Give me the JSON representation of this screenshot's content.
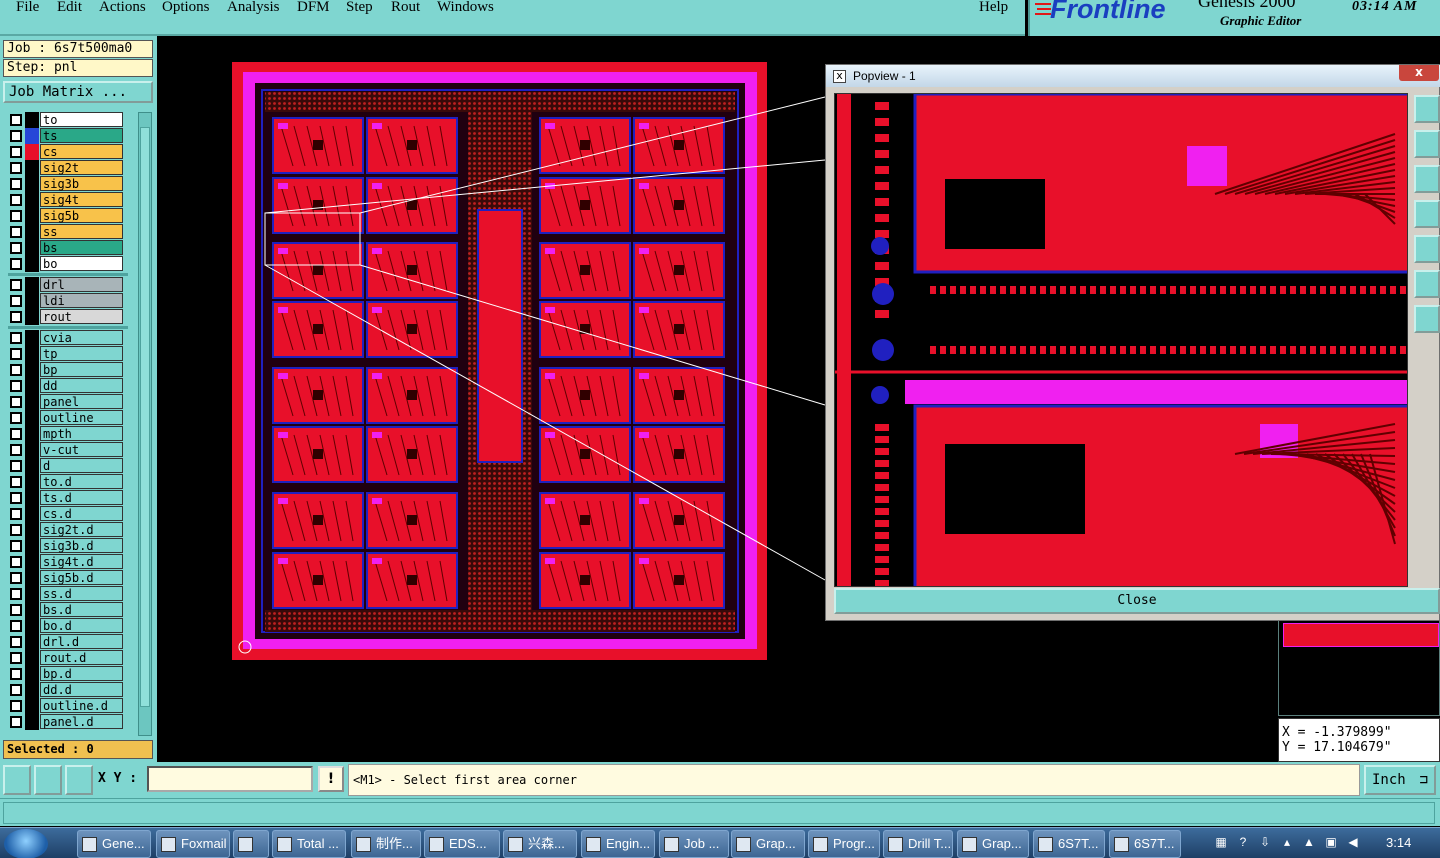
{
  "menu": [
    {
      "label": "File"
    },
    {
      "label": "Edit"
    },
    {
      "label": "Actions"
    },
    {
      "label": "Options"
    },
    {
      "label": "Analysis"
    },
    {
      "label": "DFM"
    },
    {
      "label": "Step"
    },
    {
      "label": "Rout"
    },
    {
      "label": "Windows"
    },
    {
      "label": "Help"
    }
  ],
  "brand": {
    "logo": "Frontline",
    "product": "Genesis 2000",
    "subtitle": "Graphic Editor",
    "clock": "03:14 AM"
  },
  "left": {
    "job": "Job : 6s7t500ma0",
    "step": "Step: pnl",
    "job_matrix": "Job Matrix ...",
    "selected": "Selected : 0"
  },
  "layers": [
    {
      "name": "to",
      "bg": "#ffffff",
      "swatch": "#000000"
    },
    {
      "name": "ts",
      "bg": "#2aa888",
      "swatch": "#2646d8"
    },
    {
      "name": "cs",
      "bg": "#f8c24a",
      "swatch": "#e8102a"
    },
    {
      "name": "sig2t",
      "bg": "#f8c24a",
      "swatch": "#000000"
    },
    {
      "name": "sig3b",
      "bg": "#f8c24a",
      "swatch": "#000000"
    },
    {
      "name": "sig4t",
      "bg": "#f8c24a",
      "swatch": "#000000"
    },
    {
      "name": "sig5b",
      "bg": "#f8c24a",
      "swatch": "#000000"
    },
    {
      "name": "ss",
      "bg": "#f8c24a",
      "swatch": "#000000"
    },
    {
      "name": "bs",
      "bg": "#2aa888",
      "swatch": "#000000"
    },
    {
      "name": "bo",
      "bg": "#ffffff",
      "swatch": "#000000"
    },
    {
      "name": "drl",
      "bg": "#a8b4b8",
      "swatch": "#000000"
    },
    {
      "name": "ldi",
      "bg": "#a8b4b8",
      "swatch": "#000000"
    },
    {
      "name": "rout",
      "bg": "#d8d8d8",
      "swatch": "#000000"
    },
    {
      "name": "cvia",
      "bg": "#7fd6d0",
      "swatch": "#000000"
    },
    {
      "name": "tp",
      "bg": "#7fd6d0",
      "swatch": "#000000"
    },
    {
      "name": "bp",
      "bg": "#7fd6d0",
      "swatch": "#000000"
    },
    {
      "name": "dd",
      "bg": "#7fd6d0",
      "swatch": "#000000"
    },
    {
      "name": "panel",
      "bg": "#7fd6d0",
      "swatch": "#000000"
    },
    {
      "name": "outline",
      "bg": "#7fd6d0",
      "swatch": "#000000"
    },
    {
      "name": "mpth",
      "bg": "#7fd6d0",
      "swatch": "#000000"
    },
    {
      "name": "v-cut",
      "bg": "#7fd6d0",
      "swatch": "#000000"
    },
    {
      "name": "d",
      "bg": "#7fd6d0",
      "swatch": "#000000"
    },
    {
      "name": "to.d",
      "bg": "#7fd6d0",
      "swatch": "#000000"
    },
    {
      "name": "ts.d",
      "bg": "#7fd6d0",
      "swatch": "#000000"
    },
    {
      "name": "cs.d",
      "bg": "#7fd6d0",
      "swatch": "#000000"
    },
    {
      "name": "sig2t.d",
      "bg": "#7fd6d0",
      "swatch": "#000000"
    },
    {
      "name": "sig3b.d",
      "bg": "#7fd6d0",
      "swatch": "#000000"
    },
    {
      "name": "sig4t.d",
      "bg": "#7fd6d0",
      "swatch": "#000000"
    },
    {
      "name": "sig5b.d",
      "bg": "#7fd6d0",
      "swatch": "#000000"
    },
    {
      "name": "ss.d",
      "bg": "#7fd6d0",
      "swatch": "#000000"
    },
    {
      "name": "bs.d",
      "bg": "#7fd6d0",
      "swatch": "#000000"
    },
    {
      "name": "bo.d",
      "bg": "#7fd6d0",
      "swatch": "#000000"
    },
    {
      "name": "drl.d",
      "bg": "#7fd6d0",
      "swatch": "#000000"
    },
    {
      "name": "rout.d",
      "bg": "#7fd6d0",
      "swatch": "#000000"
    },
    {
      "name": "bp.d",
      "bg": "#7fd6d0",
      "swatch": "#000000"
    },
    {
      "name": "dd.d",
      "bg": "#7fd6d0",
      "swatch": "#000000"
    },
    {
      "name": "outline.d",
      "bg": "#7fd6d0",
      "swatch": "#000000"
    },
    {
      "name": "panel.d",
      "bg": "#7fd6d0",
      "swatch": "#000000"
    }
  ],
  "popview": {
    "title": "Popview - 1",
    "close_label": "Close",
    "close_x": "x"
  },
  "coords": {
    "x": "X = -1.379899\"",
    "y": "Y = 17.104679\""
  },
  "command": {
    "xy_label": "X Y :",
    "xy_value": "",
    "excl": "!",
    "prompt": "<M1> - Select first area corner",
    "unit": "Inch"
  },
  "taskbar": {
    "items": [
      {
        "label": "Gene..."
      },
      {
        "label": "Foxmail"
      },
      {
        "label": ""
      },
      {
        "label": "Total ..."
      },
      {
        "label": "制作..."
      },
      {
        "label": "EDS..."
      },
      {
        "label": "兴森..."
      },
      {
        "label": "Engin..."
      },
      {
        "label": "Job ..."
      },
      {
        "label": "Grap..."
      },
      {
        "label": "Progr..."
      },
      {
        "label": "Drill T..."
      },
      {
        "label": "Grap..."
      },
      {
        "label": "6S7T..."
      },
      {
        "label": "6S7T..."
      }
    ],
    "time": "3:14"
  },
  "colors": {
    "accent": "#7fd6d0",
    "copper": "#e8102a",
    "magenta": "#f020f0",
    "blue": "#2020c0"
  }
}
